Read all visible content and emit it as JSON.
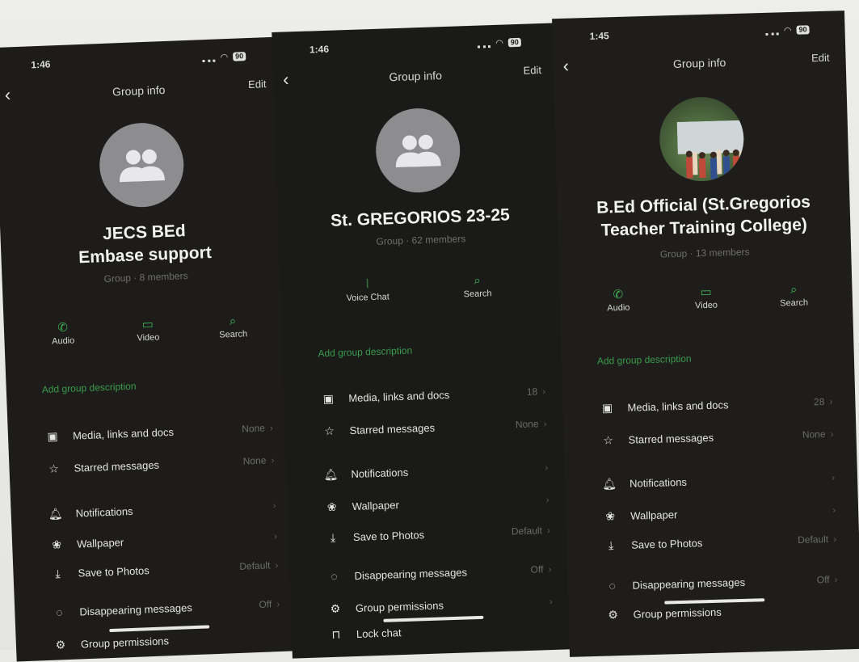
{
  "panels": [
    {
      "status": {
        "time": "1:46",
        "battery": "90"
      },
      "nav": {
        "title": "Group info",
        "edit": "Edit"
      },
      "group": {
        "name_line1": "JECS BEd",
        "name_line2": "Embase support",
        "subtitle": "Group · 8 members"
      },
      "actions": {
        "a1": "Audio",
        "a2": "Video",
        "a3": "Search"
      },
      "description": "Add group description",
      "rows": {
        "media": {
          "label": "Media, links and docs",
          "value": "None"
        },
        "starred": {
          "label": "Starred messages",
          "value": "None"
        },
        "notifications": {
          "label": "Notifications"
        },
        "wallpaper": {
          "label": "Wallpaper"
        },
        "save": {
          "label": "Save to Photos",
          "value": "Default"
        },
        "disappearing": {
          "label": "Disappearing messages",
          "value": "Off"
        },
        "permissions": {
          "label": "Group permissions"
        }
      }
    },
    {
      "status": {
        "time": "1:46",
        "battery": "90"
      },
      "nav": {
        "title": "Group info",
        "edit": "Edit"
      },
      "group": {
        "name_line1": "St. GREGORIOS 23-25",
        "subtitle": "Group · 62 members"
      },
      "actions": {
        "a1": "Voice Chat",
        "a2": "Search"
      },
      "description": "Add group description",
      "rows": {
        "media": {
          "label": "Media, links and docs",
          "value": "18"
        },
        "starred": {
          "label": "Starred messages",
          "value": "None"
        },
        "notifications": {
          "label": "Notifications"
        },
        "wallpaper": {
          "label": "Wallpaper"
        },
        "save": {
          "label": "Save to Photos",
          "value": "Default"
        },
        "disappearing": {
          "label": "Disappearing messages",
          "value": "Off"
        },
        "permissions": {
          "label": "Group permissions"
        },
        "lock": {
          "label": "Lock chat"
        }
      }
    },
    {
      "status": {
        "time": "1:45",
        "battery": "90"
      },
      "nav": {
        "title": "Group info",
        "edit": "Edit"
      },
      "group": {
        "name_line1": "B.Ed Official (St.Gregorios",
        "name_line2": "Teacher Training College)",
        "subtitle": "Group · 13 members"
      },
      "actions": {
        "a1": "Audio",
        "a2": "Video",
        "a3": "Search"
      },
      "description": "Add group description",
      "rows": {
        "media": {
          "label": "Media, links and docs",
          "value": "28"
        },
        "starred": {
          "label": "Starred messages",
          "value": "None"
        },
        "notifications": {
          "label": "Notifications"
        },
        "wallpaper": {
          "label": "Wallpaper"
        },
        "save": {
          "label": "Save to Photos",
          "value": "Default"
        },
        "disappearing": {
          "label": "Disappearing messages",
          "value": "Off"
        },
        "permissions": {
          "label": "Group permissions"
        }
      }
    }
  ],
  "colors": {
    "accent": "#3fb054",
    "background": "#1b1b19",
    "muted": "#6e6e6a"
  }
}
